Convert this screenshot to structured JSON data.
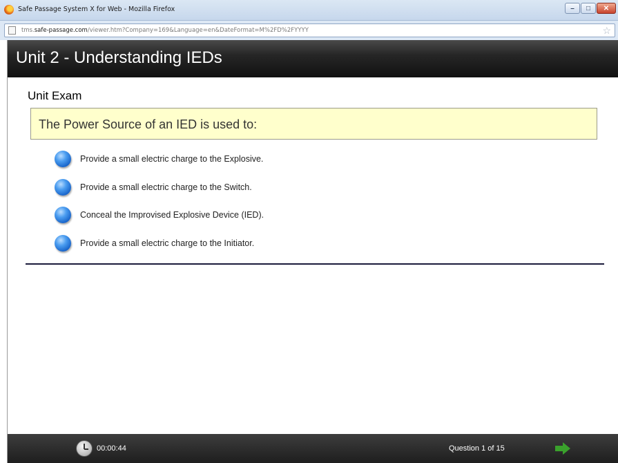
{
  "window": {
    "title": "Safe Passage System X for Web - Mozilla Firefox",
    "controls": {
      "minimize": "–",
      "maximize": "□",
      "close": "✕"
    }
  },
  "urlbar": {
    "prefix": "tms.",
    "domain": "safe-passage.com",
    "path": "/viewer.htm?Company=169&Language=en&DateFormat=M%2FD%2FYYYY",
    "star_icon": "☆"
  },
  "header": {
    "title": "Unit 2 - Understanding IEDs"
  },
  "exam": {
    "label": "Unit Exam",
    "question": "The Power Source of an IED is used to:",
    "answers": [
      {
        "label": "Provide a small electric charge to the Explosive."
      },
      {
        "label": "Provide a small electric charge to the Switch."
      },
      {
        "label": "Conceal the Improvised Explosive Device (IED)."
      },
      {
        "label": "Provide a small electric charge to the Initiator."
      }
    ]
  },
  "footer": {
    "timer": "00:00:44",
    "question_count": "Question 1 of 15",
    "next_icon": "green-right-arrow"
  },
  "colors": {
    "header_bg": "#1a1a1a",
    "question_bg": "#ffffcc",
    "radio_blue": "#1763c9",
    "next_arrow": "#3aa12c"
  }
}
